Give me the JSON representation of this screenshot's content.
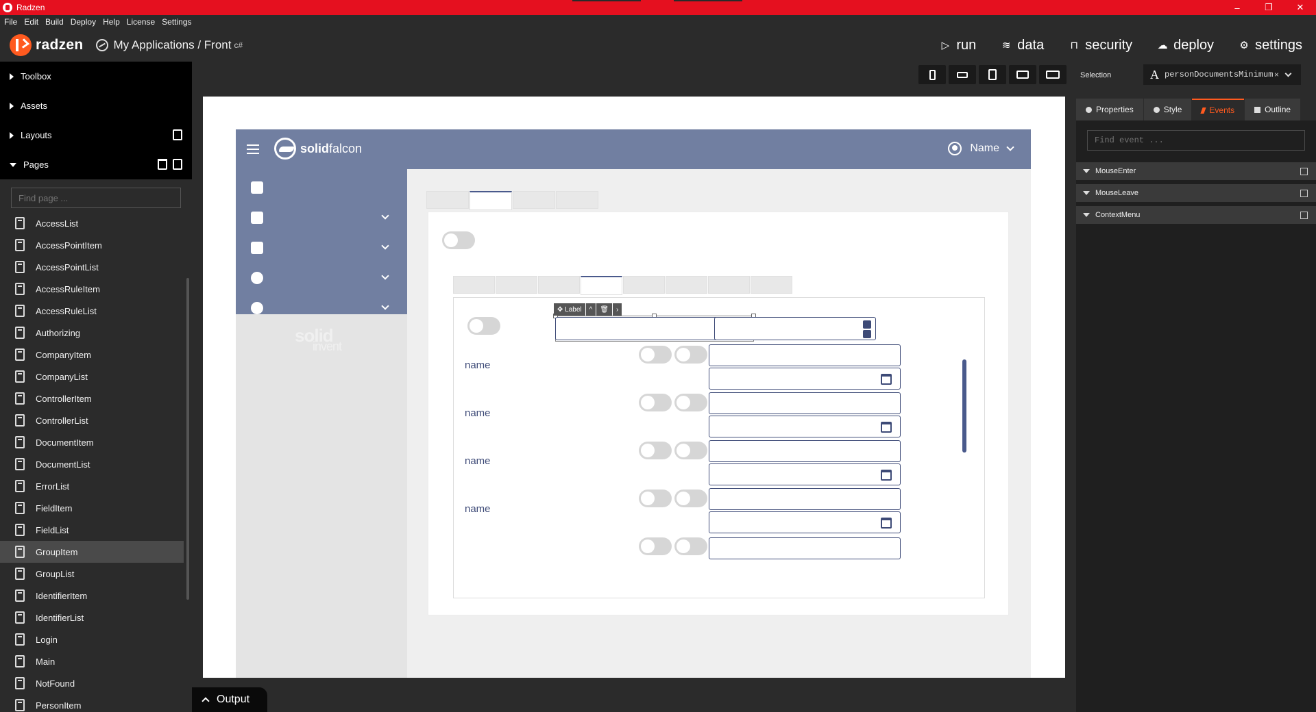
{
  "window": {
    "title": "Radzen",
    "controls": [
      "–",
      "❐",
      "✕"
    ]
  },
  "menubar": [
    "File",
    "Edit",
    "Build",
    "Deploy",
    "Help",
    "License",
    "Settings"
  ],
  "app": {
    "brand": "radzen",
    "breadcrumb": "My Applications / Front",
    "breadcrumb_badge": "c#",
    "nav": [
      {
        "label": "run",
        "icon": "play-icon"
      },
      {
        "label": "data",
        "icon": "database-icon"
      },
      {
        "label": "security",
        "icon": "lock-icon"
      },
      {
        "label": "deploy",
        "icon": "cloud-upload-icon"
      },
      {
        "label": "settings",
        "icon": "gear-icon"
      }
    ]
  },
  "sidebar": {
    "sections": [
      "Toolbox",
      "Assets",
      "Layouts",
      "Pages"
    ],
    "find_placeholder": "Find page ...",
    "pages": [
      "AccessList",
      "AccessPointItem",
      "AccessPointList",
      "AccessRuleItem",
      "AccessRuleList",
      "Authorizing",
      "CompanyItem",
      "CompanyList",
      "ControllerItem",
      "ControllerList",
      "DocumentItem",
      "DocumentList",
      "ErrorList",
      "FieldItem",
      "FieldList",
      "GroupItem",
      "GroupList",
      "IdentifierItem",
      "IdentifierList",
      "Login",
      "Main",
      "NotFound",
      "PersonItem"
    ],
    "active_page": "GroupItem"
  },
  "output_tab": "Output",
  "preview": {
    "brand_bold": "solid",
    "brand_light": "falcon",
    "user": "Name",
    "side_logo_bold": "solid",
    "side_logo_light": "invent",
    "selection_bar": [
      "Label"
    ],
    "row_labels": [
      "name",
      "name",
      "name",
      "name"
    ]
  },
  "right": {
    "selection_label": "Selection",
    "selection_glyph": "A",
    "selection_value": "personDocumentsMinimum",
    "selection_clear": "×",
    "tabs": [
      "Properties",
      "Style",
      "Events",
      "Outline"
    ],
    "active_tab": "Events",
    "find_placeholder": "Find event ...",
    "events": [
      "MouseEnter",
      "MouseLeave",
      "ContextMenu"
    ]
  },
  "colors": {
    "titlebar": "#e5101f",
    "accent": "#ff5a1f",
    "preview_header": "#717fa1",
    "input_border": "#3d4a77",
    "save_button": "#2a8ad4"
  }
}
